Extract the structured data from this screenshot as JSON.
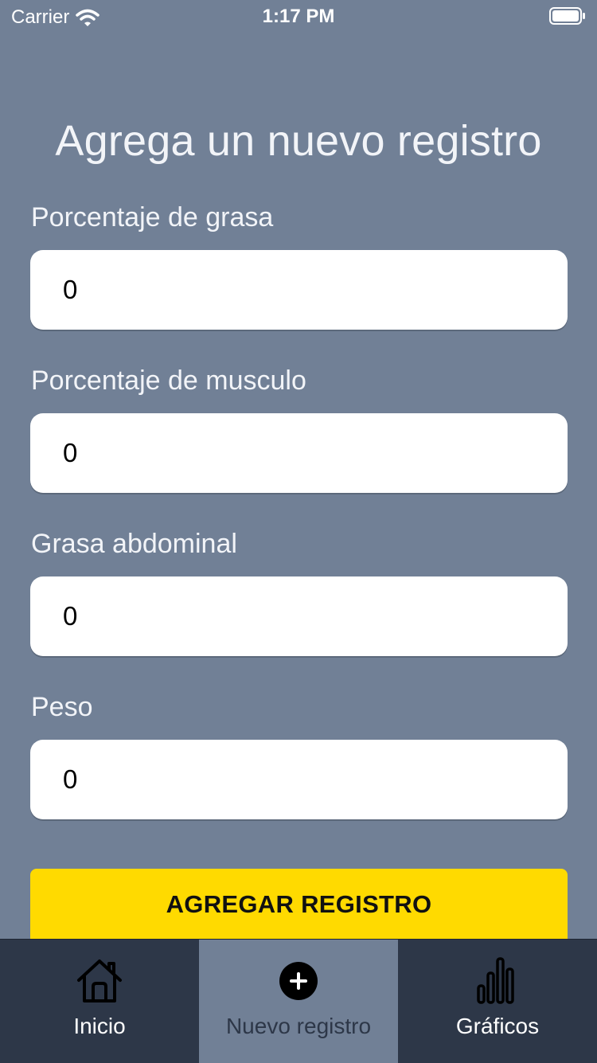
{
  "status_bar": {
    "carrier": "Carrier",
    "time": "1:17 PM"
  },
  "page": {
    "title": "Agrega un nuevo registro"
  },
  "form": {
    "fields": [
      {
        "label": "Porcentaje de grasa",
        "value": "0"
      },
      {
        "label": "Porcentaje de musculo",
        "value": "0"
      },
      {
        "label": "Grasa abdominal",
        "value": "0"
      },
      {
        "label": "Peso",
        "value": "0"
      }
    ],
    "submit_label": "AGREGAR REGISTRO"
  },
  "tab_bar": {
    "tabs": [
      {
        "label": "Inicio",
        "icon": "home-icon",
        "active": false
      },
      {
        "label": "Nuevo registro",
        "icon": "add-circle-icon",
        "active": true
      },
      {
        "label": "Gráficos",
        "icon": "bar-chart-icon",
        "active": false
      }
    ]
  },
  "colors": {
    "background": "#718096",
    "tab_bar": "#2d3748",
    "button": "#ffda00",
    "input": "#ffffff"
  }
}
